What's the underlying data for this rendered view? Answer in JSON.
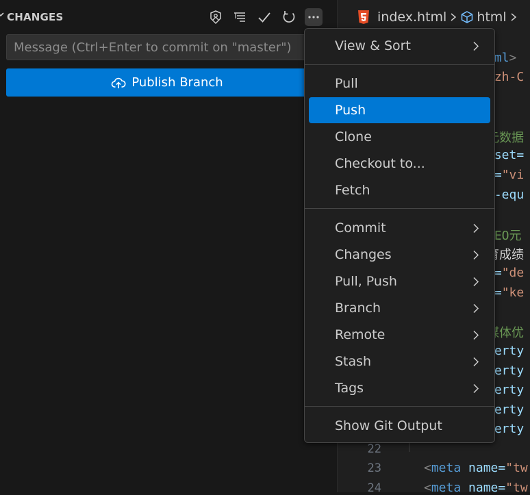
{
  "scm": {
    "title": "CHANGES",
    "toolbar": [
      "graph-icon",
      "view-as-tree-icon",
      "commit-check-icon",
      "refresh-icon",
      "more-actions-icon"
    ],
    "commit_placeholder": "Message (Ctrl+Enter to commit on \"master\")",
    "publish_label": "Publish Branch"
  },
  "breadcrumb": {
    "file": "index.html",
    "element": "html"
  },
  "editor": {
    "line_numbers": [
      "22",
      "23",
      "24"
    ],
    "fragments": [
      "tml",
      ">",
      "\"zh-C",
      "元数据",
      "rset=",
      "e=",
      "\"vi",
      "p-equ",
      "SEO元",
      "育成绩",
      "e=",
      "\"de",
      "e=",
      "\"ke",
      "媒体优",
      "perty",
      "perty",
      "perty",
      "perty",
      "perty",
      "<",
      "meta",
      "name=",
      "\"tw",
      "<",
      "meta",
      "name=",
      "\"tw"
    ]
  },
  "menu": {
    "items": [
      {
        "label": "View & Sort",
        "submenu": true
      },
      {
        "label": "Pull",
        "submenu": false
      },
      {
        "label": "Push",
        "submenu": false,
        "active": true
      },
      {
        "label": "Clone",
        "submenu": false
      },
      {
        "label": "Checkout to...",
        "submenu": false
      },
      {
        "label": "Fetch",
        "submenu": false
      },
      {
        "label": "Commit",
        "submenu": true
      },
      {
        "label": "Changes",
        "submenu": true
      },
      {
        "label": "Pull, Push",
        "submenu": true
      },
      {
        "label": "Branch",
        "submenu": true
      },
      {
        "label": "Remote",
        "submenu": true
      },
      {
        "label": "Stash",
        "submenu": true
      },
      {
        "label": "Tags",
        "submenu": true
      },
      {
        "label": "Show Git Output",
        "submenu": false
      }
    ]
  },
  "colors": {
    "accent": "#0078d4",
    "background": "#181818",
    "editor_background": "#1f1f1f",
    "html_icon": "#e44d26",
    "tag": "#569cd6",
    "attribute": "#9cdcfe",
    "string": "#ce9178",
    "comment": "#6a9955"
  }
}
